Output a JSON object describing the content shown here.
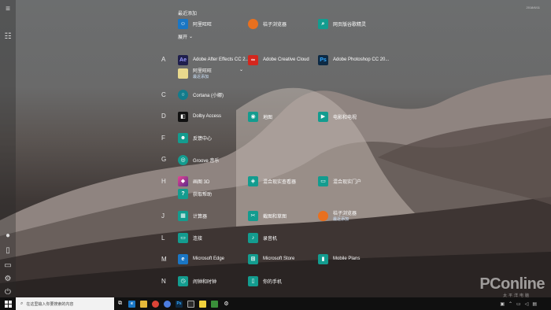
{
  "recently_added": {
    "label": "最近添加",
    "items": [
      {
        "label": "阿里旺旺",
        "icon": "aliwangwang-icon",
        "color": "#1a76c4"
      },
      {
        "label": "桔子浏览器",
        "icon": "orange-browser-icon",
        "color": "#e8701f"
      },
      {
        "label": "网页版谷歌精灵",
        "icon": "web-assistant-icon",
        "color": "#139c8f"
      }
    ],
    "expand_label": "展开"
  },
  "sections": [
    {
      "letter": "A",
      "apps": [
        {
          "label": "Adobe After Effects CC 2...",
          "icon": "after-effects-icon",
          "glyph": "Ae",
          "color": "#1f1f4c"
        },
        {
          "label": "Adobe Creative Cloud",
          "icon": "creative-cloud-icon",
          "glyph": "Cc",
          "color": "#d4261d"
        },
        {
          "label": "Adobe Photoshop CC 20...",
          "icon": "photoshop-icon",
          "glyph": "Ps",
          "color": "#0d2a44"
        },
        {
          "label": "阿里旺旺",
          "sub": "最近添加",
          "icon": "aliwangwang-folder-icon",
          "color": "#e9d98d"
        }
      ]
    },
    {
      "letter": "C",
      "apps": [
        {
          "label": "Cortana (小娜)",
          "icon": "cortana-icon",
          "color": "#137c8c"
        }
      ]
    },
    {
      "letter": "D",
      "apps": [
        {
          "label": "Dolby Access",
          "icon": "dolby-icon",
          "color": "#111111"
        },
        {
          "label": "地图",
          "icon": "maps-icon",
          "color": "#139c8f"
        },
        {
          "label": "电影和电视",
          "icon": "movies-tv-icon",
          "color": "#139c8f"
        }
      ]
    },
    {
      "letter": "F",
      "apps": [
        {
          "label": "反馈中心",
          "icon": "feedback-hub-icon",
          "color": "#139c8f"
        }
      ]
    },
    {
      "letter": "G",
      "apps": [
        {
          "label": "Groove 音乐",
          "icon": "groove-music-icon",
          "color": "#139c8f"
        }
      ]
    },
    {
      "letter": "H",
      "apps": [
        {
          "label": "画图 3D",
          "icon": "paint-3d-icon",
          "color": "#5a2b8c"
        },
        {
          "label": "混合现实查看器",
          "icon": "mixed-reality-viewer-icon",
          "color": "#139c8f"
        },
        {
          "label": "混合现实门户",
          "icon": "mixed-reality-portal-icon",
          "color": "#139c8f"
        },
        {
          "label": "获取帮助",
          "icon": "get-help-icon",
          "color": "#139c8f"
        }
      ]
    },
    {
      "letter": "J",
      "apps": [
        {
          "label": "计算器",
          "icon": "calculator-icon",
          "color": "#139c8f"
        },
        {
          "label": "截图和草图",
          "icon": "snip-sketch-icon",
          "color": "#139c8f"
        },
        {
          "label": "桔子浏览器",
          "sub": "最近添加",
          "icon": "orange-browser-icon",
          "color": "#e8701f"
        }
      ]
    },
    {
      "letter": "L",
      "apps": [
        {
          "label": "连接",
          "icon": "connect-icon",
          "color": "#139c8f"
        },
        {
          "label": "录音机",
          "icon": "voice-recorder-icon",
          "color": "#139c8f"
        }
      ]
    },
    {
      "letter": "M",
      "apps": [
        {
          "label": "Microsoft Edge",
          "icon": "edge-icon",
          "color": "#1a76c4"
        },
        {
          "label": "Microsoft Store",
          "icon": "store-icon",
          "color": "#139c8f"
        },
        {
          "label": "Mobile Plans",
          "icon": "mobile-plans-icon",
          "color": "#139c8f"
        }
      ]
    },
    {
      "letter": "N",
      "apps": [
        {
          "label": "闹钟和时钟",
          "icon": "alarms-clock-icon",
          "color": "#139c8f"
        },
        {
          "label": "你的手机",
          "icon": "your-phone-icon",
          "color": "#139c8f"
        }
      ]
    }
  ],
  "taskbar": {
    "search_placeholder": "在这里输入你要搜索的内容",
    "apps": [
      {
        "icon": "task-view-icon",
        "glyph": "",
        "color": "#101010"
      },
      {
        "icon": "edge-icon",
        "glyph": "e",
        "color": "#1a76c4"
      },
      {
        "icon": "file-explorer-icon",
        "glyph": "",
        "color": "#e6b93a"
      },
      {
        "icon": "chrome-icon",
        "glyph": "",
        "color": "#db4437"
      },
      {
        "icon": "chrome-alt-icon",
        "glyph": "",
        "color": "#4c7de0"
      },
      {
        "icon": "photoshop-icon",
        "glyph": "Ps",
        "color": "#0d2a44"
      },
      {
        "icon": "photos-icon",
        "glyph": "",
        "color": "#2b2b2b"
      },
      {
        "icon": "sticky-notes-icon",
        "glyph": "",
        "color": "#f0d13c"
      },
      {
        "icon": "app-icon",
        "glyph": "",
        "color": "#3a8f3a"
      },
      {
        "icon": "settings-icon",
        "glyph": "",
        "color": "#101010"
      }
    ],
    "date": "2018/6/11"
  },
  "watermark": {
    "text": "PConline",
    "sub": "太平洋电脑"
  }
}
